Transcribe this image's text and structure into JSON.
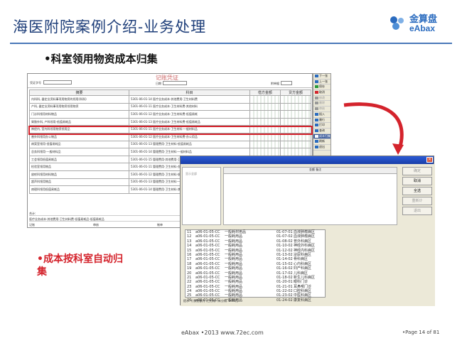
{
  "slide": {
    "title": "海医附院案例介绍-业务处理",
    "logo_cn": "金算盘",
    "logo_en": "eAbax",
    "bullet_main": "•科室领用物资成本归集",
    "bullet_sub": "•成本按科室自动归集",
    "footer_left": "eAbax •2013 www.72ec.com",
    "footer_right": "•Page 14 of 81"
  },
  "form": {
    "caption": "记账凭证",
    "voucher_label": "凭证字号",
    "date_label": "日期",
    "attach_label": "附单据",
    "col_summary": "摘要",
    "col_account": "科目",
    "col_debit": "借方金额",
    "col_credit": "贷方金额",
    "rows": [
      {
        "summary": "内科科, 器定业资料事项用物资的领用(科科)",
        "account": "5301-06-01-14 医疗业务成本-其他费用-卫生材料费"
      },
      {
        "summary": "产科, 器定业资料事项用物资领用物资",
        "account": "5301-06-01-11 医疗业务成本-卫生材料费-其他材料"
      },
      {
        "summary": "门诊科领用材料物品",
        "account": "5301-06-01-12 医疗业务成本-卫生材料费-低值易耗"
      },
      {
        "summary": "胃肠外科, 产科领用-低值易耗品",
        "account": "5301-06-01-13 医疗业务成本-卫生材料费-低值易耗品",
        "highlight": true
      },
      {
        "summary": "神经内, 室内科领用物资领用品",
        "account": "5301-06-01-11 医疗业务成本-卫生材料-一般材料品"
      },
      {
        "summary": "普外科领用办公物品",
        "account": "5301-06-01-12 医疗业务成本-卫生材料费-办公用品"
      },
      {
        "summary": "病案室领用-低值易耗品",
        "account": "5301-06-01-13 管理费用-卫生材料-低值易耗品"
      },
      {
        "summary": "总务科领用-一般材料品",
        "account": "5301-06-01-14 管理费用-卫生材料-一般材料品"
      },
      {
        "summary": "工会领用低值易耗品",
        "account": "5301-06-01-15 管理费用-其他费用-卫生材料"
      },
      {
        "summary": "检验室领用物品",
        "account": "5301-06-01-11 管理费用-卫生材料-办公用品"
      },
      {
        "summary": "放射科领用材料物品",
        "account": "5301-06-01-12 管理费用-卫生材料-低值易耗"
      },
      {
        "summary": "超声科领用物品",
        "account": "5301-06-01-13 管理费用-卫生材料-一般材料"
      },
      {
        "summary": "病理科领用低值易耗品",
        "account": "5301-06-01-14 管理费用-卫生材料-其他"
      }
    ],
    "total_label": "合计:",
    "footer_note": "医疗业务成本-其他费用-卫生材料费-低值易耗品-低值易耗品",
    "maker_label": "记账",
    "reviewer_label": "审核",
    "creator_label": "制单"
  },
  "toolbar": {
    "items": [
      {
        "label": "下一张",
        "color": "#2a6bbf",
        "active": true
      },
      {
        "label": "上一张",
        "color": "#2a6bbf",
        "active": true
      },
      {
        "label": "保存",
        "color": "#2a9a3a",
        "active": true
      },
      {
        "label": "取消",
        "color": "#d4232c",
        "active": true
      },
      {
        "label": "修改",
        "color": "#999999",
        "active": false
      },
      {
        "label": "删除",
        "color": "#999999",
        "active": false
      },
      {
        "label": "审核",
        "color": "#999999",
        "active": false
      },
      {
        "label": "插入",
        "color": "#2a6bbf",
        "active": true
      },
      {
        "label": "删行",
        "color": "#2a6bbf",
        "active": true
      },
      {
        "label": "打印",
        "color": "#2a6bbf",
        "active": true
      },
      {
        "label": "查询",
        "color": "#2a6bbf",
        "active": true
      },
      {
        "label": "成本归集",
        "color": "#ffffff",
        "active": true,
        "selected": true
      },
      {
        "label": "刷新",
        "color": "#2a6bbf",
        "active": true
      },
      {
        "label": "退出",
        "color": "#2a6bbf",
        "active": true
      }
    ]
  },
  "window": {
    "col_header": "金额 备注",
    "buttons": [
      {
        "label": "确定",
        "enabled": false
      },
      {
        "label": "取消",
        "enabled": true
      },
      {
        "label": "全选",
        "enabled": true
      },
      {
        "label": "重新计",
        "enabled": false
      },
      {
        "label": "退出",
        "enabled": false
      }
    ],
    "left_label": "显示全部",
    "list_rows": [
      {
        "no": "11",
        "code": "a06-01-05-CC",
        "name": "一般耗材用品",
        "date": "01-07-01",
        "dept": "血液肿瘤病区"
      },
      {
        "no": "12",
        "code": "a06-01-05-CC",
        "name": "一般耗用品",
        "date": "01-07-02",
        "dept": "血液肿瘤病区"
      },
      {
        "no": "13",
        "code": "a06-01-05-CC",
        "name": "一般耗用品",
        "date": "01-08-02",
        "dept": "普外科病区"
      },
      {
        "no": "14",
        "code": "a06-01-05-CC",
        "name": "一般耗用品",
        "date": "01-10-02",
        "dept": "神经外科病区"
      },
      {
        "no": "15",
        "code": "a06-01-05-CC",
        "name": "一般耗用品",
        "date": "01-12-02",
        "dept": "神经内科病区"
      },
      {
        "no": "16",
        "code": "a06-01-05-CC",
        "name": "一般耗用品",
        "date": "01-13-02",
        "dept": "泌尿科病区"
      },
      {
        "no": "17",
        "code": "a06-01-05-CC",
        "name": "一般耗用品",
        "date": "01-14-02",
        "dept": "骨科病区"
      },
      {
        "no": "18",
        "code": "a06-01-05-CC",
        "name": "一般耗用品",
        "date": "01-15-02",
        "dept": "心内科病区"
      },
      {
        "no": "19",
        "code": "a06-01-05-CC",
        "name": "一般耗用品",
        "date": "01-16-02",
        "dept": "妇产科病区"
      },
      {
        "no": "20",
        "code": "a06-01-05-CC",
        "name": "一般耗用品",
        "date": "01-17-02",
        "dept": "儿科病区"
      },
      {
        "no": "21",
        "code": "a06-01-05-CC",
        "name": "一般耗用品",
        "date": "01-18-02",
        "dept": "新生儿科病区"
      },
      {
        "no": "22",
        "code": "a06-01-05-CC",
        "name": "一般耗用品",
        "date": "01-20-01",
        "dept": "眼科门诊"
      },
      {
        "no": "23",
        "code": "a06-01-05-CC",
        "name": "一般耗用品",
        "date": "01-21-01",
        "dept": "耳鼻喉门诊"
      },
      {
        "no": "24",
        "code": "a06-01-05-CC",
        "name": "一般耗用品",
        "date": "01-22-02",
        "dept": "口腔科病区"
      },
      {
        "no": "25",
        "code": "a06-01-05-CC",
        "name": "一般耗用品",
        "date": "01-23-02",
        "dept": "中医科病区"
      },
      {
        "no": "26",
        "code": "a06-01-05-CC",
        "name": "一般耗用品",
        "date": "01-24-02",
        "dept": "康复科病区"
      }
    ],
    "status": "提示: 行数总额为 ,已分摊: ,未分摊: 0.00元."
  }
}
